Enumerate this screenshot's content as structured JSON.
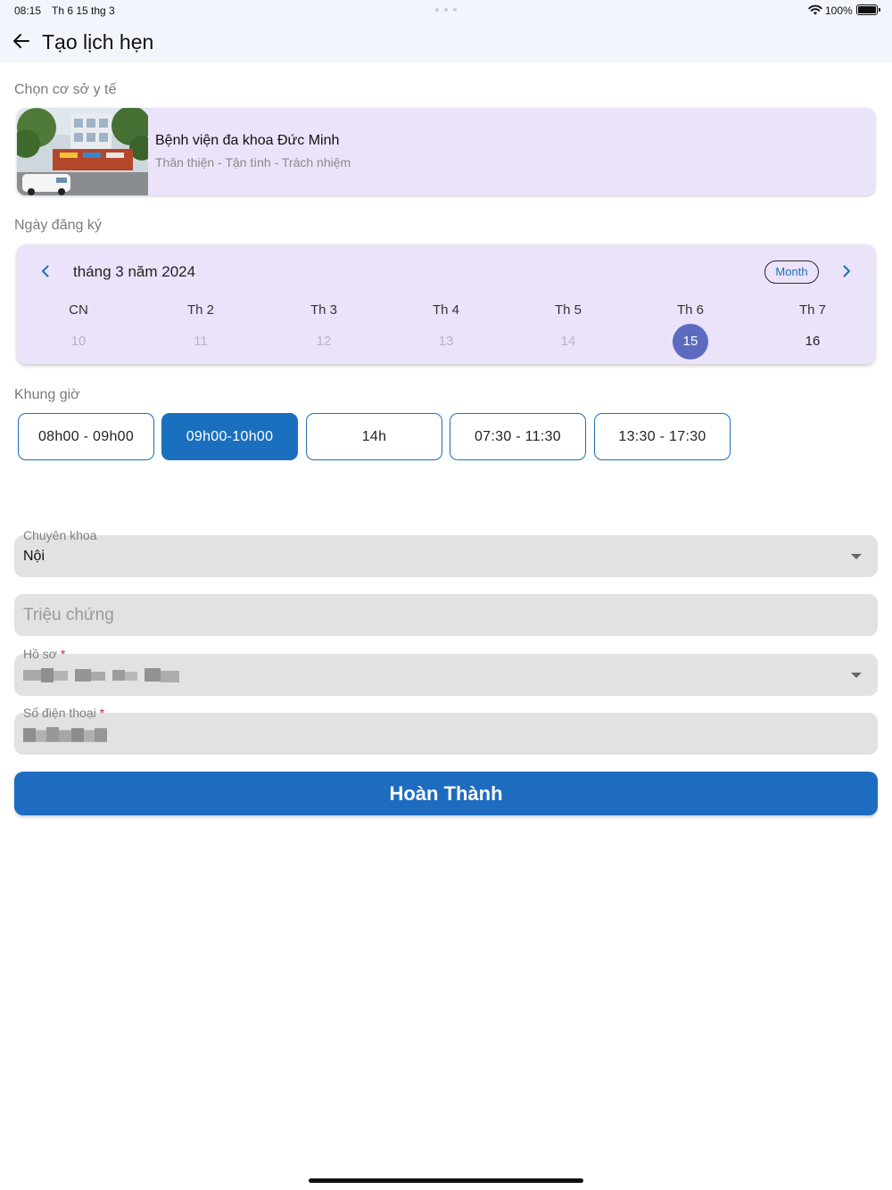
{
  "status_bar": {
    "time": "08:15",
    "date": "Th 6 15 thg 3",
    "battery": "100%"
  },
  "app_bar": {
    "title": "Tạo lịch hẹn"
  },
  "facility": {
    "section_label": "Chọn cơ sở y tế",
    "name": "Bệnh viện đa khoa Đức Minh",
    "slogan": "Thân thiện - Tận tình - Trách nhiệm"
  },
  "date_picker": {
    "section_label": "Ngày đăng ký",
    "month_label": "tháng 3 năm 2024",
    "format_button": "Month",
    "weekdays": [
      "CN",
      "Th 2",
      "Th 3",
      "Th 4",
      "Th 5",
      "Th 6",
      "Th 7"
    ],
    "days": [
      "10",
      "11",
      "12",
      "13",
      "14",
      "15",
      "16"
    ],
    "selected_day": "15"
  },
  "time_slots": {
    "section_label": "Khung giờ",
    "slots": [
      "08h00 - 09h00",
      "09h00-10h00",
      "14h",
      "07:30 - 11:30",
      "13:30 - 17:30"
    ],
    "selected": "09h00-10h00"
  },
  "form": {
    "specialty": {
      "label": "Chuyên khoa",
      "value": "Nội"
    },
    "symptoms": {
      "placeholder": "Triệu chứng"
    },
    "profile": {
      "label": "Hồ sơ",
      "required_mark": "*"
    },
    "phone": {
      "label": "Số điện thoại",
      "required_mark": "*"
    }
  },
  "submit_button": "Hoàn Thành",
  "colors": {
    "primary": "#1e6cc0",
    "card_bg": "#ebe3fa",
    "selected_day": "#5c6bc0",
    "field_bg": "#e2e2e2",
    "required": "#d32f2f"
  }
}
